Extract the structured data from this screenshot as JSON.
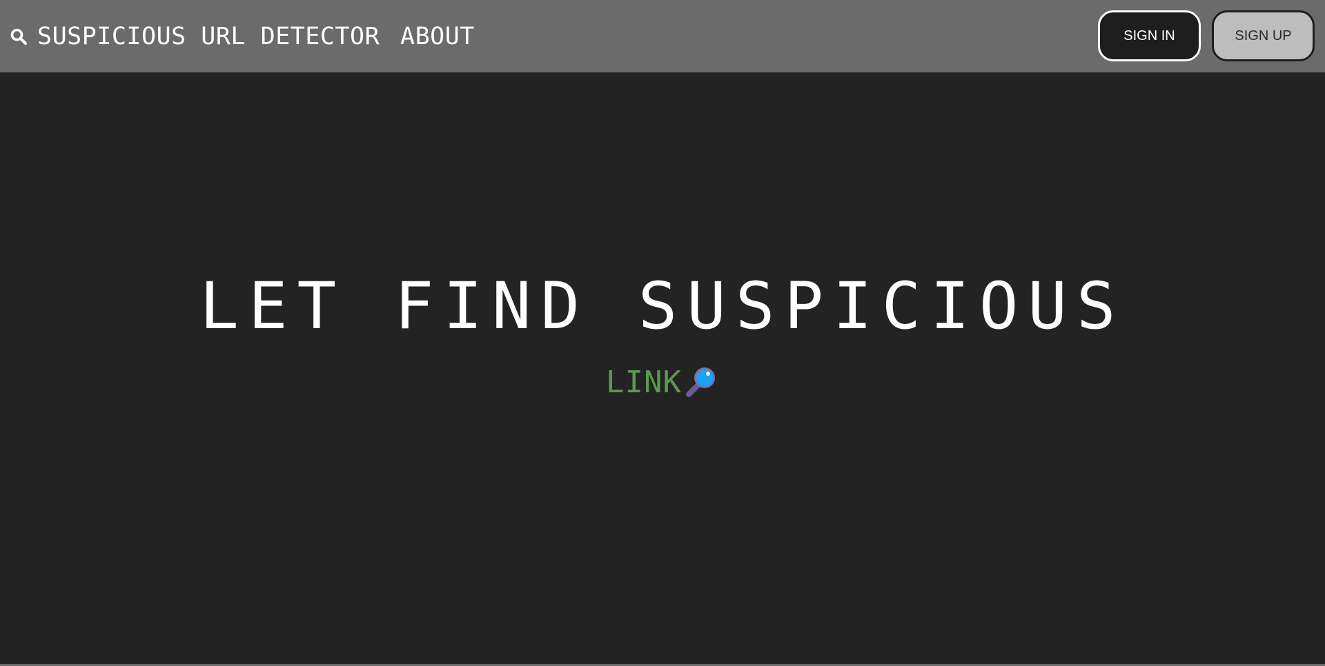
{
  "nav": {
    "brand_label": "SUSPICIOUS URL DETECTOR",
    "brand_icon": "search-icon",
    "about_label": "ABOUT",
    "sign_in_label": "SIGN IN",
    "sign_up_label": "SIGN UP"
  },
  "hero": {
    "title": "LET FIND SUSPICIOUS",
    "link_label": "LINK",
    "link_icon": "magnifier-icon"
  },
  "colors": {
    "navbar_bg": "#6b6b6b",
    "page_bg": "#232323",
    "link_green": "#5b9a50",
    "sign_in_bg": "#1e1e1e",
    "sign_up_bg": "#bdbdbd"
  }
}
